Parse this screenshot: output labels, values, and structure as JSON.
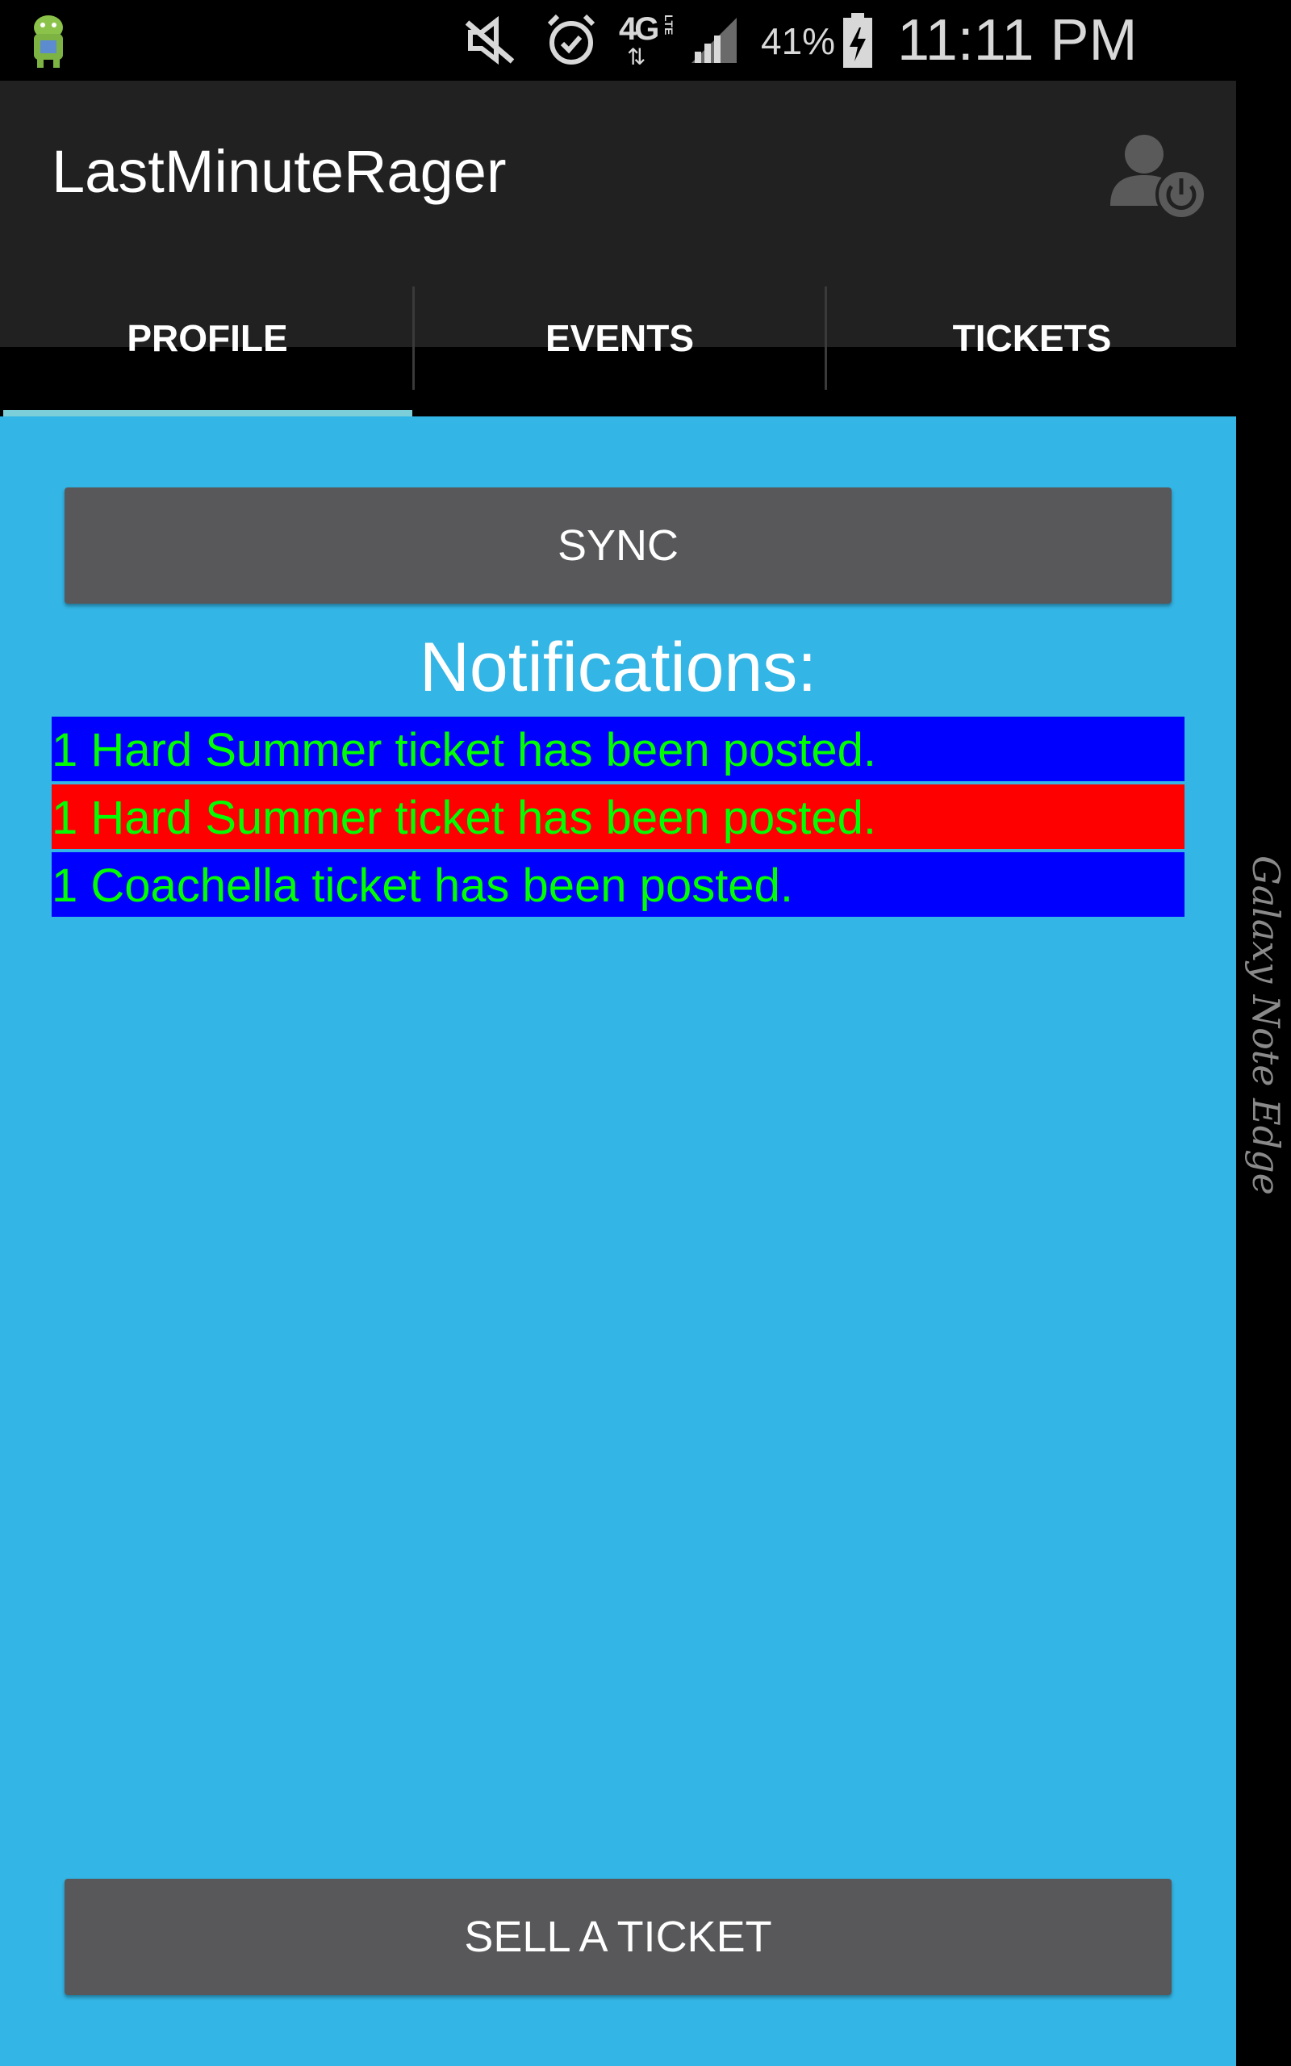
{
  "status_bar": {
    "battery": "41%",
    "time": "11:11 PM",
    "network": "4G",
    "network_sub": "LTE",
    "icons": [
      "android-debug-icon",
      "mute-icon",
      "alarm-icon",
      "network-4g-lte-icon",
      "signal-icon",
      "battery-charging-icon"
    ]
  },
  "app_bar": {
    "title": "LastMinuteRager",
    "user_icon": "user-logout-icon"
  },
  "tabs": [
    {
      "label": "PROFILE",
      "selected": true
    },
    {
      "label": "EVENTS",
      "selected": false
    },
    {
      "label": "TICKETS",
      "selected": false
    }
  ],
  "main": {
    "sync_label": "SYNC",
    "notifications_title": "Notifications:",
    "notifications": [
      {
        "text": "1 Hard Summer ticket has been posted.",
        "bg": "#0000ff",
        "color": "#00ff00"
      },
      {
        "text": "1 Hard Summer ticket has been posted.",
        "bg": "#ff0000",
        "color": "#00ff00"
      },
      {
        "text": "1 Coachella ticket has been posted.",
        "bg": "#0000ff",
        "color": "#00ff00"
      }
    ],
    "sell_label": "SELL A TICKET"
  },
  "edge_screen": {
    "label": "Galaxy Note Edge"
  },
  "colors": {
    "app_bar": "#212121",
    "content_bg": "#33b5e5",
    "button_bg": "#58585a",
    "tab_indicator": "#7ccfd8"
  }
}
